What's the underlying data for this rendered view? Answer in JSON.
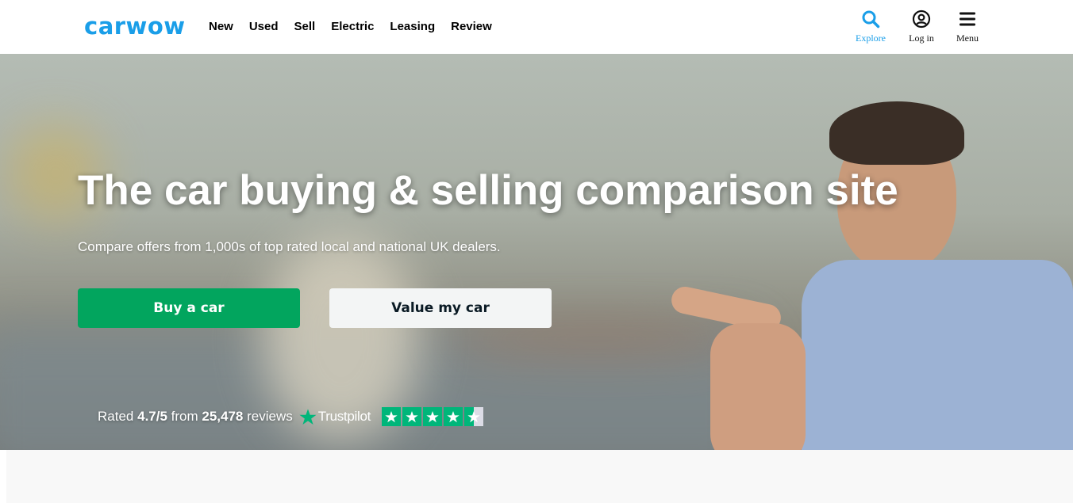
{
  "brand": {
    "logo_text": "carwow",
    "accent": "#1a9ee8",
    "green": "#02a55e",
    "trustpilot_green": "#00b67a"
  },
  "nav": {
    "items": [
      {
        "label": "New"
      },
      {
        "label": "Used"
      },
      {
        "label": "Sell"
      },
      {
        "label": "Electric"
      },
      {
        "label": "Leasing"
      },
      {
        "label": "Review"
      }
    ]
  },
  "header_actions": {
    "explore": {
      "label": "Explore",
      "icon": "search-icon"
    },
    "login": {
      "label": "Log in",
      "icon": "user-circle-icon"
    },
    "menu": {
      "label": "Menu",
      "icon": "hamburger-icon"
    }
  },
  "hero": {
    "title": "The car buying & selling comparison site",
    "subtitle": "Compare offers from 1,000s of top rated local and national UK dealers.",
    "buy_button": "Buy a car",
    "value_button": "Value my car"
  },
  "rating": {
    "prefix": "Rated",
    "score": "4.7/5",
    "middle": "from",
    "count": "25,478",
    "suffix": "reviews",
    "provider": "Trustpilot",
    "stars_value": 4.5
  }
}
